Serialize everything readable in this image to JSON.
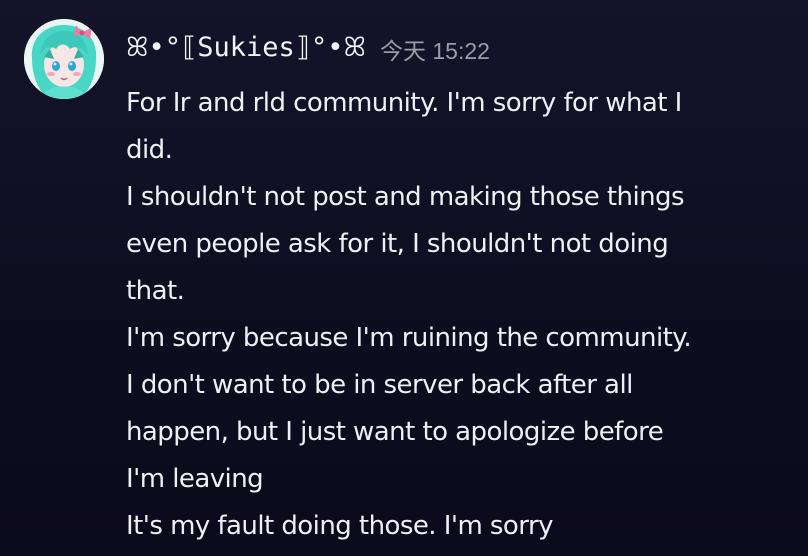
{
  "message": {
    "author": {
      "username": "ꕤ•°⟦Sukies⟧°•ꕤ",
      "avatar_icon": "anime-avatar-icon"
    },
    "timestamp": "今天 15:22",
    "lines": [
      "For Ir and rld community. I'm sorry for what I",
      "did.",
      "I shouldn't not post and making those things",
      "even people ask for it, I shouldn't not doing",
      "that.",
      "I'm sorry because I'm ruining the community.",
      "I don't want to be in server back after all",
      "happen, but I just want to apologize before",
      "I'm leaving",
      "It's my fault doing those. I'm sorry"
    ]
  },
  "colors": {
    "background": "#100f22",
    "text": "#eef0f3",
    "timestamp": "#9a9ca6",
    "avatar_hair": "#3fd8c8"
  }
}
